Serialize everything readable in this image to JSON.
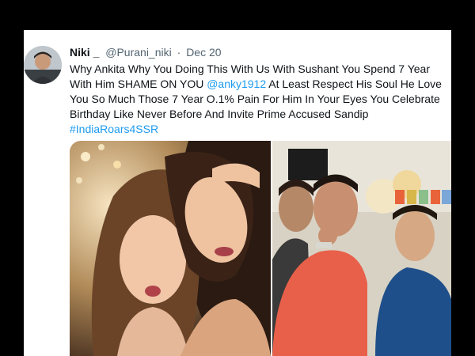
{
  "tweet": {
    "display_name": "Niki _",
    "handle": "@Purani_niki",
    "separator": "·",
    "date": "Dec 20",
    "text_lines": [
      "Why Ankita Why You Doing This With Us With Sushant You Spend 7 Year",
      "With Him SHAME ON YOU",
      "At Least Respect His Soul He Love",
      "You So Much Those 7 Year O.1% Pain For Him In Your Eyes You Celebrate",
      "Birthday Like Never Before And Invite Prime Accused Sandip"
    ],
    "mention": "@anky1912",
    "hashtag": "#IndiaRoars4SSR",
    "media": [
      "photo-two-women-selfie",
      "photo-group-party"
    ]
  },
  "colors": {
    "link": "#1d9bf0",
    "text": "#0f1419",
    "secondary": "#536471",
    "frame": "#000000"
  }
}
